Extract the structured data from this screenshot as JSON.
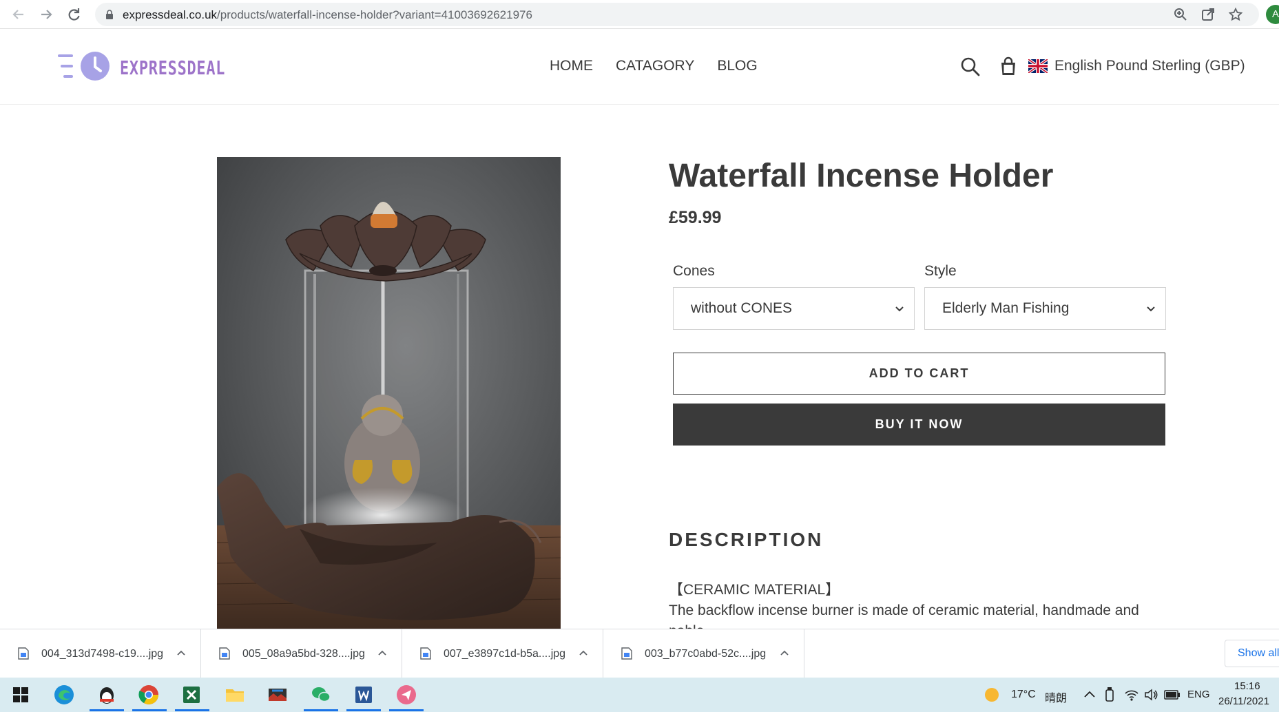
{
  "browser": {
    "url_host": "expressdeal.co.uk",
    "url_path": "/products/waterfall-incense-holder?variant=41003692621976",
    "profile_initial": "A",
    "icons": [
      "back-icon",
      "forward-icon",
      "reload-icon",
      "lock-icon",
      "zoom-icon",
      "share-icon",
      "star-icon"
    ]
  },
  "site": {
    "logo_text": "EXPRESSDEAL",
    "nav": [
      "HOME",
      "CATAGORY",
      "BLOG"
    ],
    "currency": "English Pound Sterling (GBP)",
    "accent_color": "#9d73c9"
  },
  "product": {
    "title": "Waterfall Incense Holder",
    "price": "£59.99",
    "options": [
      {
        "label": "Cones",
        "value": "without CONES"
      },
      {
        "label": "Style",
        "value": "Elderly Man Fishing"
      }
    ],
    "add_to_cart": "ADD TO CART",
    "buy_now": "BUY IT NOW",
    "description_heading": "DESCRIPTION",
    "description_subheading": "【CERAMIC MATERIAL】",
    "description_text": "The backflow incense burner is made of ceramic material, handmade and noble"
  },
  "downloads": {
    "items": [
      "004_313d7498-c19....jpg",
      "005_08a9a5bd-328....jpg",
      "007_e3897c1d-b5a....jpg",
      "003_b77c0abd-52c....jpg"
    ],
    "show_all": "Show all"
  },
  "taskbar": {
    "apps": [
      "windows-start-icon",
      "edge-icon",
      "qq-icon",
      "chrome-icon",
      "excel-icon",
      "file-explorer-icon",
      "media-icon",
      "wechat-icon",
      "word-icon",
      "send-app-icon"
    ],
    "weather_temp": "17°C",
    "weather_desc": "晴朗",
    "language": "ENG",
    "time": "15:16",
    "date": "26/11/2021"
  }
}
